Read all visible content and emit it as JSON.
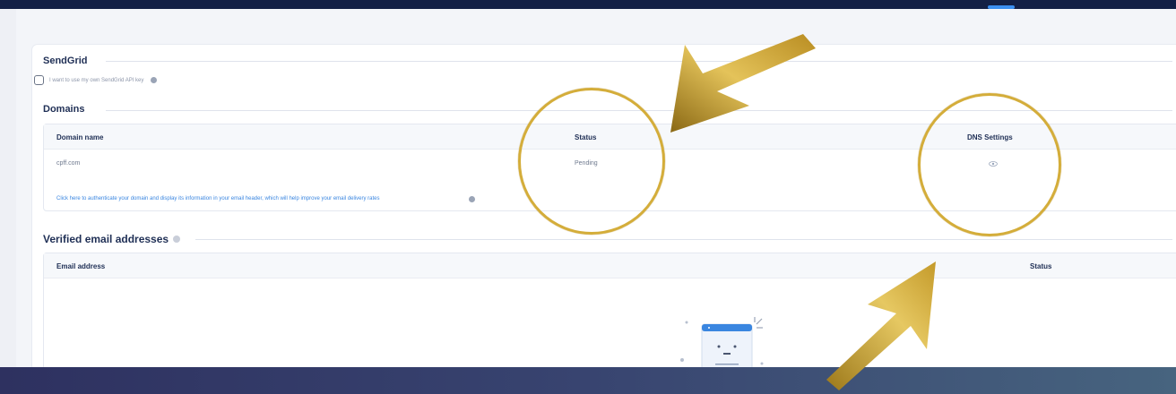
{
  "sendgrid": {
    "title": "SendGrid",
    "checkbox_label": "I want to use my own SendGrid API key"
  },
  "domains": {
    "title": "Domains",
    "columns": [
      "Domain name",
      "Status",
      "DNS Settings"
    ],
    "rows": [
      {
        "domain": "cpff.com",
        "status": "Pending",
        "dns_icon": "eye-icon"
      }
    ],
    "auth_link": "Click here to authenticate your domain and display its information in your email header, which will help improve your email delivery rates"
  },
  "verified": {
    "title": "Verified email addresses",
    "columns": [
      "Email address",
      "Status"
    ]
  },
  "colors": {
    "accent": "#3a86e0",
    "heading": "#1f2f55",
    "annotation": "#d4ad3a"
  }
}
